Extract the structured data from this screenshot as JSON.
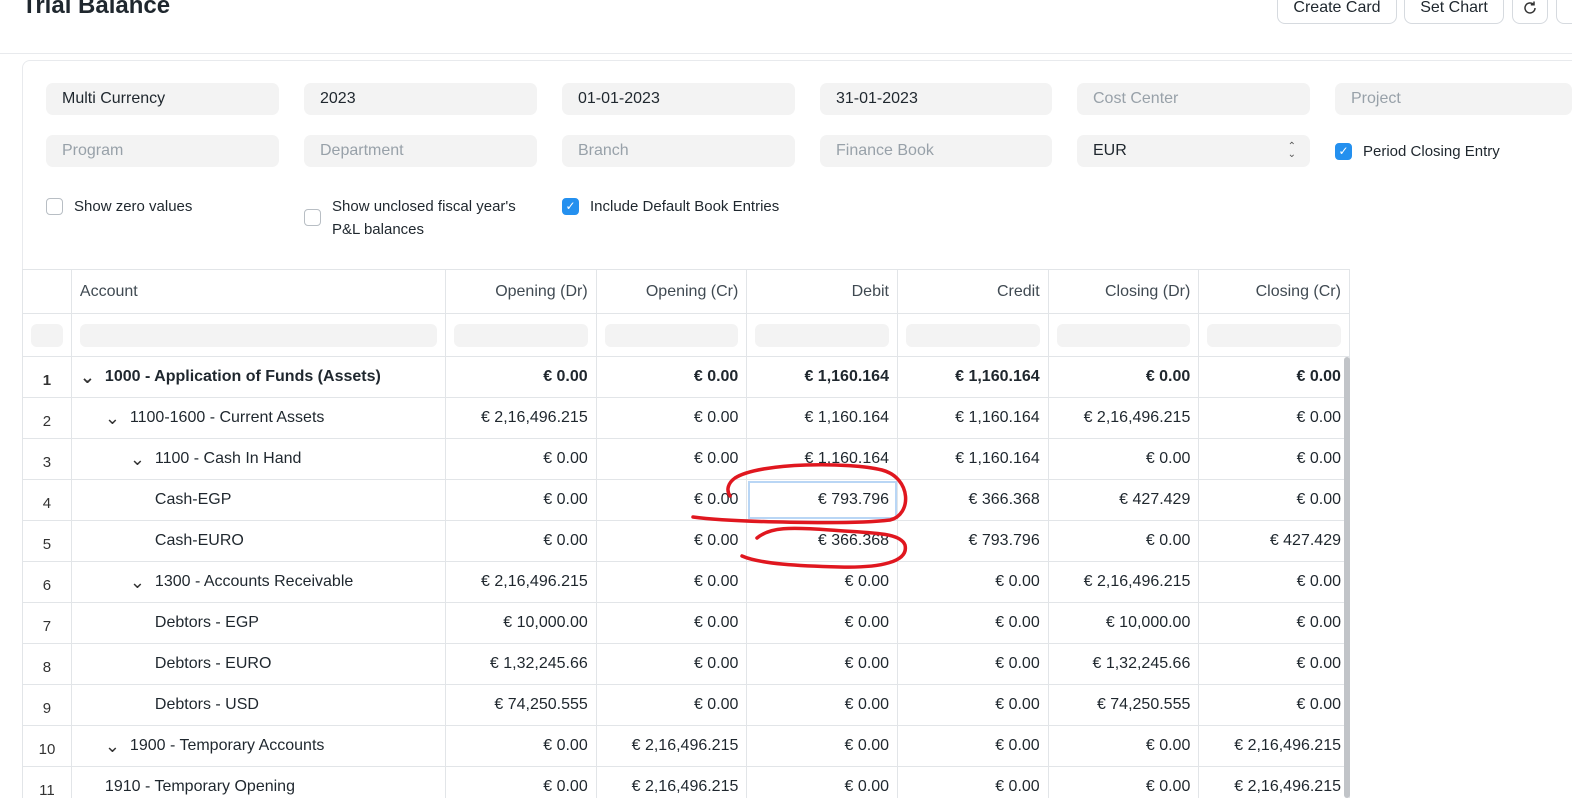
{
  "header": {
    "title": "Trial Balance",
    "create_card": "Create Card",
    "set_chart": "Set Chart",
    "refresh_icon": "refresh-icon"
  },
  "filters": {
    "company": "Multi Currency",
    "fiscal_year": "2023",
    "from_date": "01-01-2023",
    "to_date": "31-01-2023",
    "cost_center_placeholder": "Cost Center",
    "project_placeholder": "Project",
    "program_placeholder": "Program",
    "department_placeholder": "Department",
    "branch_placeholder": "Branch",
    "finance_book_placeholder": "Finance Book",
    "currency": "EUR",
    "period_closing_entry": "Period Closing Entry",
    "show_zero_values": "Show zero values",
    "show_unclosed_line1": "Show unclosed fiscal year's",
    "show_unclosed_line2": "P&L balances",
    "include_default_book": "Include Default Book Entries",
    "checked_color": "#2490ef"
  },
  "table": {
    "columns": [
      "Account",
      "Opening (Dr)",
      "Opening (Cr)",
      "Debit",
      "Credit",
      "Closing (Dr)",
      "Closing (Cr)"
    ],
    "rows": [
      {
        "n": "1",
        "account": "1000 - Application of Funds (Assets)",
        "vals": [
          "€ 0.00",
          "€ 0.00",
          "€ 1,160.164",
          "€ 1,160.164",
          "€ 0.00",
          "€ 0.00"
        ]
      },
      {
        "n": "2",
        "account": "1100-1600 - Current Assets",
        "vals": [
          "€ 2,16,496.215",
          "€ 0.00",
          "€ 1,160.164",
          "€ 1,160.164",
          "€ 2,16,496.215",
          "€ 0.00"
        ]
      },
      {
        "n": "3",
        "account": "1100 - Cash In Hand",
        "vals": [
          "€ 0.00",
          "€ 0.00",
          "€ 1,160.164",
          "€ 1,160.164",
          "€ 0.00",
          "€ 0.00"
        ]
      },
      {
        "n": "4",
        "account": "Cash-EGP",
        "vals": [
          "€ 0.00",
          "€ 0.00",
          "€ 793.796",
          "€ 366.368",
          "€ 427.429",
          "€ 0.00"
        ]
      },
      {
        "n": "5",
        "account": "Cash-EURO",
        "vals": [
          "€ 0.00",
          "€ 0.00",
          "€ 366.368",
          "€ 793.796",
          "€ 0.00",
          "€ 427.429"
        ]
      },
      {
        "n": "6",
        "account": "1300 - Accounts Receivable",
        "vals": [
          "€ 2,16,496.215",
          "€ 0.00",
          "€ 0.00",
          "€ 0.00",
          "€ 2,16,496.215",
          "€ 0.00"
        ]
      },
      {
        "n": "7",
        "account": "Debtors - EGP",
        "vals": [
          "€ 10,000.00",
          "€ 0.00",
          "€ 0.00",
          "€ 0.00",
          "€ 10,000.00",
          "€ 0.00"
        ]
      },
      {
        "n": "8",
        "account": "Debtors - EURO",
        "vals": [
          "€ 1,32,245.66",
          "€ 0.00",
          "€ 0.00",
          "€ 0.00",
          "€ 1,32,245.66",
          "€ 0.00"
        ]
      },
      {
        "n": "9",
        "account": "Debtors - USD",
        "vals": [
          "€ 74,250.555",
          "€ 0.00",
          "€ 0.00",
          "€ 0.00",
          "€ 74,250.555",
          "€ 0.00"
        ]
      },
      {
        "n": "10",
        "account": "1900 - Temporary Accounts",
        "vals": [
          "€ 0.00",
          "€ 2,16,496.215",
          "€ 0.00",
          "€ 0.00",
          "€ 0.00",
          "€ 2,16,496.215"
        ]
      },
      {
        "n": "11",
        "account": "1910 - Temporary Opening",
        "vals": [
          "€ 0.00",
          "€ 2,16,496.215",
          "€ 0.00",
          "€ 0.00",
          "€ 0.00",
          "€ 2,16,496.215"
        ]
      }
    ],
    "annotation_color": "#e0171f"
  }
}
